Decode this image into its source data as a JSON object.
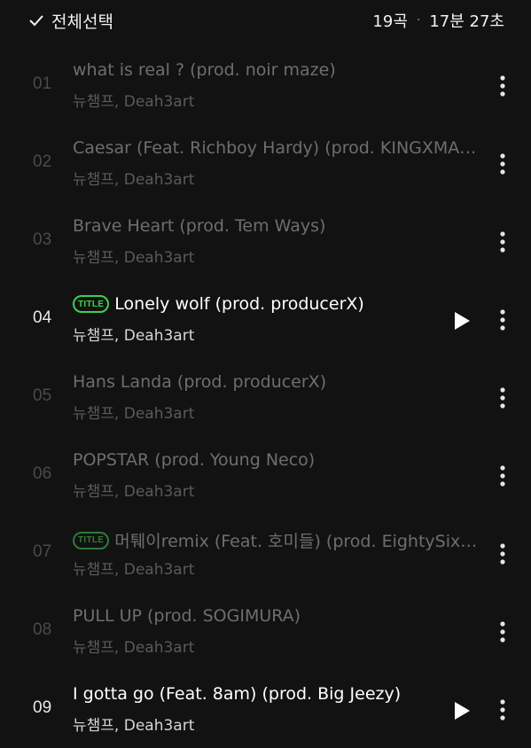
{
  "header": {
    "select_all_label": "전체선택",
    "song_count": "19곡",
    "separator": "·",
    "total_duration": "17분 27초"
  },
  "tracks": [
    {
      "number": "01",
      "title": "what is real ? (prod. noir maze)",
      "artist": "뉴챔프, Deah3art",
      "title_badge": false,
      "active": false
    },
    {
      "number": "02",
      "title": "Caesar (Feat. Richboy Hardy) (prod. KINGXMA…",
      "artist": "뉴챔프, Deah3art",
      "title_badge": false,
      "active": false
    },
    {
      "number": "03",
      "title": "Brave Heart (prod. Tem Ways)",
      "artist": "뉴챔프, Deah3art",
      "title_badge": false,
      "active": false
    },
    {
      "number": "04",
      "title": "Lonely wolf (prod. producerX)",
      "artist": "뉴챔프, Deah3art",
      "title_badge": true,
      "active": true
    },
    {
      "number": "05",
      "title": "Hans Landa (prod. producerX)",
      "artist": "뉴챔프, Deah3art",
      "title_badge": false,
      "active": false
    },
    {
      "number": "06",
      "title": "POPSTAR (prod. Young Neco)",
      "artist": "뉴챔프, Deah3art",
      "title_badge": false,
      "active": false
    },
    {
      "number": "07",
      "title": "머퉤이remix (Feat. 호미들) (prod. EightySix…",
      "artist": "뉴챔프, Deah3art",
      "title_badge": true,
      "active": false
    },
    {
      "number": "08",
      "title": "PULL UP (prod. SOGIMURA)",
      "artist": "뉴챔프, Deah3art",
      "title_badge": false,
      "active": false
    },
    {
      "number": "09",
      "title": "I gotta go (Feat. 8am) (prod. Big Jeezy)",
      "artist": "뉴챔프, Deah3art",
      "title_badge": false,
      "active": true
    }
  ],
  "badge_label": "TITLE",
  "icons": {
    "check": "check-icon",
    "play": "play-icon",
    "more": "more-vertical-icon"
  },
  "colors": {
    "background": "#121212",
    "accent_green": "#3bd14f",
    "dim_text": "#6e6e6e",
    "active_text": "#ffffff"
  }
}
